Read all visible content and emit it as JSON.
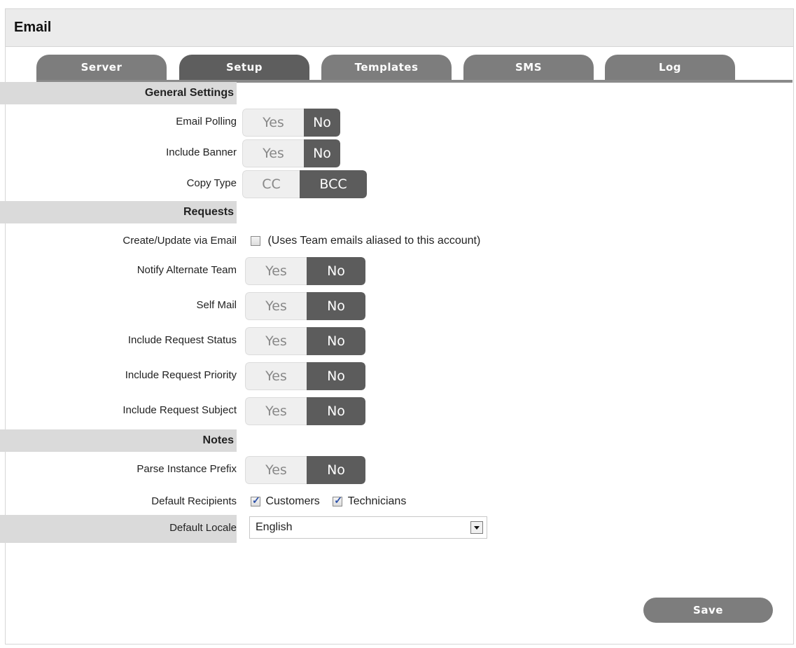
{
  "window": {
    "title": "Email"
  },
  "tabs": [
    {
      "label": "Server"
    },
    {
      "label": "Setup"
    },
    {
      "label": "Templates"
    },
    {
      "label": "SMS"
    },
    {
      "label": "Log"
    }
  ],
  "active_tab": "Setup",
  "sections": {
    "general": "General Settings",
    "requests": "Requests",
    "notes": "Notes"
  },
  "fields": {
    "email_polling": {
      "label": "Email Polling",
      "yes": "Yes",
      "no": "No",
      "value": "No"
    },
    "include_banner": {
      "label": "Include Banner",
      "yes": "Yes",
      "no": "No",
      "value": "No"
    },
    "copy_type": {
      "label": "Copy Type",
      "a": "CC",
      "b": "BCC",
      "value": "BCC"
    },
    "create_update_via_email": {
      "label": "Create/Update via Email",
      "checked": false,
      "note": "(Uses Team emails aliased to this account)"
    },
    "notify_alternate_team": {
      "label": "Notify Alternate Team",
      "yes": "Yes",
      "no": "No",
      "value": "No"
    },
    "self_mail": {
      "label": "Self Mail",
      "yes": "Yes",
      "no": "No",
      "value": "No"
    },
    "include_request_status": {
      "label": "Include Request Status",
      "yes": "Yes",
      "no": "No",
      "value": "No"
    },
    "include_request_priority": {
      "label": "Include Request Priority",
      "yes": "Yes",
      "no": "No",
      "value": "No"
    },
    "include_request_subject": {
      "label": "Include Request Subject",
      "yes": "Yes",
      "no": "No",
      "value": "No"
    },
    "parse_instance_prefix": {
      "label": "Parse Instance Prefix",
      "yes": "Yes",
      "no": "No",
      "value": "No"
    },
    "default_recipients": {
      "label": "Default Recipients",
      "customers": "Customers",
      "customers_checked": true,
      "technicians": "Technicians",
      "technicians_checked": true
    },
    "default_locale": {
      "label": "Default Locale",
      "value": "English"
    }
  },
  "actions": {
    "save": "Save"
  },
  "colors": {
    "tab": "#7d7d7d",
    "tab_active": "#5e5e5e",
    "toggle_on": "#5c5c5c",
    "section_bg": "#dadada"
  }
}
